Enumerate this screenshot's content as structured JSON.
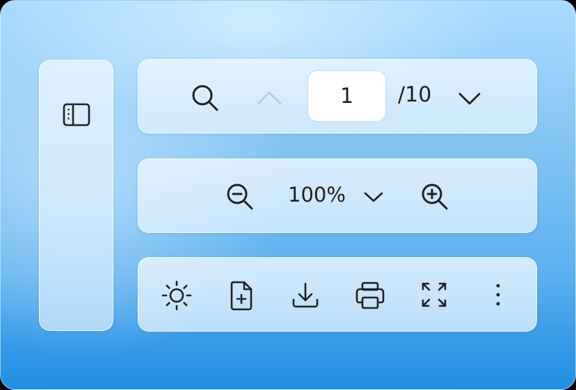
{
  "navigation": {
    "current_page": "1",
    "total_pages": "/10"
  },
  "zoom": {
    "level": "100%"
  },
  "icons": {
    "sidebar_toggle": "sidebar-toggle-icon",
    "search": "search-icon",
    "previous_page": "chevron-up-icon",
    "next_page": "chevron-down-icon",
    "zoom_out": "zoom-out-icon",
    "zoom_dropdown": "chevron-down-icon",
    "zoom_in": "zoom-in-icon",
    "brightness": "sun-icon",
    "new_document": "file-plus-icon",
    "download": "download-icon",
    "print": "printer-icon",
    "fullscreen": "expand-icon",
    "more": "more-vertical-icon"
  },
  "colors": {
    "icon": "#1f1f1f",
    "icon_disabled": "#b9c6d2"
  }
}
